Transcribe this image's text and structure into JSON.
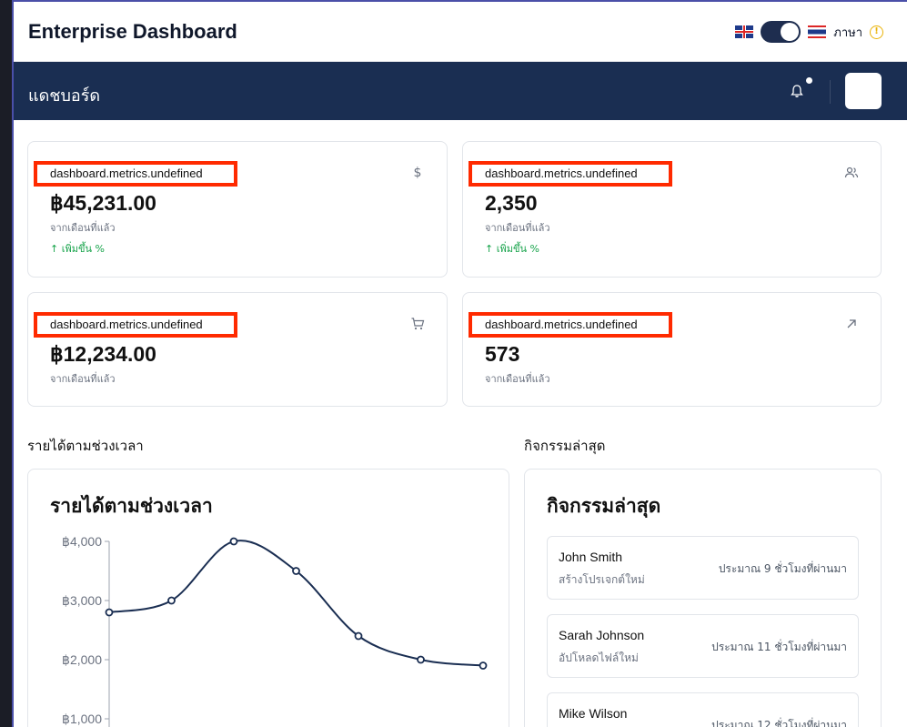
{
  "header": {
    "app_title": "Enterprise Dashboard",
    "language_label": "ภาษา",
    "warning_icon": "!"
  },
  "nav": {
    "title": "แดชบอร์ด"
  },
  "metrics": [
    {
      "label": "dashboard.metrics.undefined",
      "value": "฿45,231.00",
      "sub": "จากเดือนที่แล้ว",
      "change": "↑ เพิ่มขึ้น %",
      "icon": "$"
    },
    {
      "label": "dashboard.metrics.undefined",
      "value": "2,350",
      "sub": "จากเดือนที่แล้ว",
      "change": "↑ เพิ่มขึ้น %",
      "icon": "users-icon"
    },
    {
      "label": "dashboard.metrics.undefined",
      "value": "฿12,234.00",
      "sub": "จากเดือนที่แล้ว",
      "change": "",
      "icon": "cart-icon"
    },
    {
      "label": "dashboard.metrics.undefined",
      "value": "573",
      "sub": "จากเดือนที่แล้ว",
      "change": "",
      "icon": "arrow-up-right-icon"
    }
  ],
  "sections": {
    "revenue_heading": "รายได้ตามช่วงเวลา",
    "activity_heading": "กิจกรรมล่าสุด"
  },
  "chart_data": {
    "type": "line",
    "title": "รายได้ตามช่วงเวลา",
    "x": [
      1,
      2,
      3,
      4,
      5,
      6,
      7
    ],
    "values": [
      2800,
      3000,
      4000,
      3500,
      2400,
      2000,
      1900
    ],
    "yticks": [
      "฿4,000",
      "฿3,000",
      "฿2,000",
      "฿1,000"
    ],
    "ytick_values": [
      4000,
      3000,
      2000,
      1000
    ],
    "ylim": [
      0,
      4000
    ],
    "color": "#1a2e52"
  },
  "activity": {
    "title": "กิจกรรมล่าสุด",
    "items": [
      {
        "name": "John Smith",
        "desc": "สร้างโปรเจกต์ใหม่",
        "time": "ประมาณ 9 ชั่วโมงที่ผ่านมา"
      },
      {
        "name": "Sarah Johnson",
        "desc": "อัปโหลดไฟล์ใหม่",
        "time": "ประมาณ 11 ชั่วโมงที่ผ่านมา"
      },
      {
        "name": "Mike Wilson",
        "desc": "",
        "time": "ประมาณ 12 ชั่วโมงที่ผ่านมา"
      }
    ]
  }
}
